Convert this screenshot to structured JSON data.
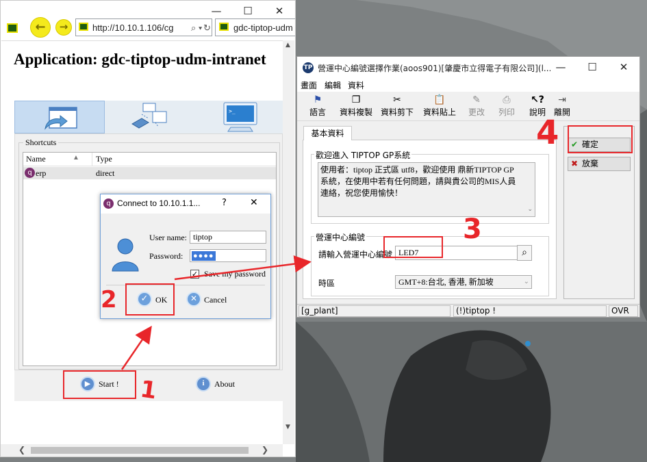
{
  "browser": {
    "address": "http://10.10.1.106/cg",
    "tab_title": "gdc-tiptop-udm",
    "app_title": "Application: gdc-tiptop-udm-intranet",
    "shortcuts_label": "Shortcuts",
    "columns": [
      "Name",
      "Type"
    ],
    "rows": [
      {
        "name": "erp",
        "type": "direct"
      }
    ],
    "start_label": "Start !",
    "about_label": "About"
  },
  "connect": {
    "title": "Connect to 10.10.1.1...",
    "help": "?",
    "username_label": "User name:",
    "username_value": "tiptop",
    "password_label": "Password:",
    "save_label": "Save my password",
    "ok_label": "OK",
    "cancel_label": "Cancel"
  },
  "erp": {
    "title": "營運中心編號選擇作業(aoos901)[肇慶市立得電子有限公司](l...",
    "menu": [
      "畫面",
      "編輯",
      "資料"
    ],
    "toolbar": [
      {
        "label": "語言",
        "icon": "flag-icon",
        "disabled": false
      },
      {
        "label": "資料複製",
        "icon": "copy-icon",
        "disabled": false
      },
      {
        "label": "資料剪下",
        "icon": "scissors-icon",
        "disabled": false
      },
      {
        "label": "資料貼上",
        "icon": "paste-icon",
        "disabled": false
      },
      {
        "label": "更改",
        "icon": "pencil-icon",
        "disabled": true
      },
      {
        "label": "列印",
        "icon": "printer-icon",
        "disabled": true
      },
      {
        "label": "說明",
        "icon": "help-icon",
        "disabled": false
      },
      {
        "label": "離開",
        "icon": "exit-icon",
        "disabled": false
      }
    ],
    "tab": "基本資料",
    "welcome_title": "歡迎進入 TIPTOP GP系統",
    "welcome_text": "使用者：tiptop 正式區 utf8，歡迎使用 鼎新TIPTOP GP系統，在使用中若有任何問題，請與貴公司的MIS人員連絡，祝您使用愉快！",
    "center_group": "營運中心編號",
    "center_label": "請輸入營運中心編號",
    "center_value": "LED7",
    "timezone_label": "時區",
    "timezone_value": "GMT+8:台北, 香港, 新加坡",
    "confirm_label": "確定",
    "discard_label": "放棄",
    "status": [
      "[g_plant]",
      "(!)tiptop !",
      "OVR"
    ]
  },
  "annotations": [
    "1",
    "2",
    "3",
    "4"
  ],
  "colors": {
    "annotation": "#e8262a",
    "selection": "#c7dcf2"
  }
}
